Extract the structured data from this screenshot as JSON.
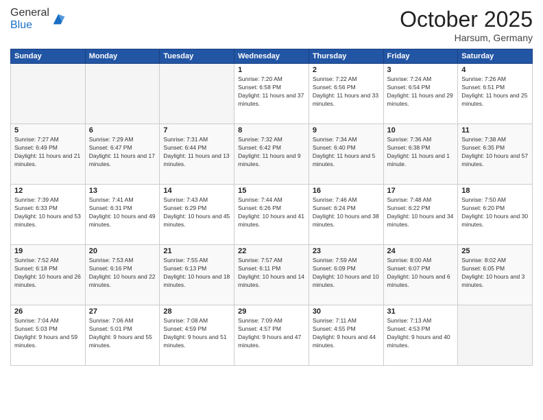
{
  "header": {
    "logo_general": "General",
    "logo_blue": "Blue",
    "month": "October 2025",
    "location": "Harsum, Germany"
  },
  "days_of_week": [
    "Sunday",
    "Monday",
    "Tuesday",
    "Wednesday",
    "Thursday",
    "Friday",
    "Saturday"
  ],
  "weeks": [
    [
      {
        "day": "",
        "info": ""
      },
      {
        "day": "",
        "info": ""
      },
      {
        "day": "",
        "info": ""
      },
      {
        "day": "1",
        "info": "Sunrise: 7:20 AM\nSunset: 6:58 PM\nDaylight: 11 hours and 37 minutes."
      },
      {
        "day": "2",
        "info": "Sunrise: 7:22 AM\nSunset: 6:56 PM\nDaylight: 11 hours and 33 minutes."
      },
      {
        "day": "3",
        "info": "Sunrise: 7:24 AM\nSunset: 6:54 PM\nDaylight: 11 hours and 29 minutes."
      },
      {
        "day": "4",
        "info": "Sunrise: 7:26 AM\nSunset: 6:51 PM\nDaylight: 11 hours and 25 minutes."
      }
    ],
    [
      {
        "day": "5",
        "info": "Sunrise: 7:27 AM\nSunset: 6:49 PM\nDaylight: 11 hours and 21 minutes."
      },
      {
        "day": "6",
        "info": "Sunrise: 7:29 AM\nSunset: 6:47 PM\nDaylight: 11 hours and 17 minutes."
      },
      {
        "day": "7",
        "info": "Sunrise: 7:31 AM\nSunset: 6:44 PM\nDaylight: 11 hours and 13 minutes."
      },
      {
        "day": "8",
        "info": "Sunrise: 7:32 AM\nSunset: 6:42 PM\nDaylight: 11 hours and 9 minutes."
      },
      {
        "day": "9",
        "info": "Sunrise: 7:34 AM\nSunset: 6:40 PM\nDaylight: 11 hours and 5 minutes."
      },
      {
        "day": "10",
        "info": "Sunrise: 7:36 AM\nSunset: 6:38 PM\nDaylight: 11 hours and 1 minute."
      },
      {
        "day": "11",
        "info": "Sunrise: 7:38 AM\nSunset: 6:35 PM\nDaylight: 10 hours and 57 minutes."
      }
    ],
    [
      {
        "day": "12",
        "info": "Sunrise: 7:39 AM\nSunset: 6:33 PM\nDaylight: 10 hours and 53 minutes."
      },
      {
        "day": "13",
        "info": "Sunrise: 7:41 AM\nSunset: 6:31 PM\nDaylight: 10 hours and 49 minutes."
      },
      {
        "day": "14",
        "info": "Sunrise: 7:43 AM\nSunset: 6:29 PM\nDaylight: 10 hours and 45 minutes."
      },
      {
        "day": "15",
        "info": "Sunrise: 7:44 AM\nSunset: 6:26 PM\nDaylight: 10 hours and 41 minutes."
      },
      {
        "day": "16",
        "info": "Sunrise: 7:46 AM\nSunset: 6:24 PM\nDaylight: 10 hours and 38 minutes."
      },
      {
        "day": "17",
        "info": "Sunrise: 7:48 AM\nSunset: 6:22 PM\nDaylight: 10 hours and 34 minutes."
      },
      {
        "day": "18",
        "info": "Sunrise: 7:50 AM\nSunset: 6:20 PM\nDaylight: 10 hours and 30 minutes."
      }
    ],
    [
      {
        "day": "19",
        "info": "Sunrise: 7:52 AM\nSunset: 6:18 PM\nDaylight: 10 hours and 26 minutes."
      },
      {
        "day": "20",
        "info": "Sunrise: 7:53 AM\nSunset: 6:16 PM\nDaylight: 10 hours and 22 minutes."
      },
      {
        "day": "21",
        "info": "Sunrise: 7:55 AM\nSunset: 6:13 PM\nDaylight: 10 hours and 18 minutes."
      },
      {
        "day": "22",
        "info": "Sunrise: 7:57 AM\nSunset: 6:11 PM\nDaylight: 10 hours and 14 minutes."
      },
      {
        "day": "23",
        "info": "Sunrise: 7:59 AM\nSunset: 6:09 PM\nDaylight: 10 hours and 10 minutes."
      },
      {
        "day": "24",
        "info": "Sunrise: 8:00 AM\nSunset: 6:07 PM\nDaylight: 10 hours and 6 minutes."
      },
      {
        "day": "25",
        "info": "Sunrise: 8:02 AM\nSunset: 6:05 PM\nDaylight: 10 hours and 3 minutes."
      }
    ],
    [
      {
        "day": "26",
        "info": "Sunrise: 7:04 AM\nSunset: 5:03 PM\nDaylight: 9 hours and 59 minutes."
      },
      {
        "day": "27",
        "info": "Sunrise: 7:06 AM\nSunset: 5:01 PM\nDaylight: 9 hours and 55 minutes."
      },
      {
        "day": "28",
        "info": "Sunrise: 7:08 AM\nSunset: 4:59 PM\nDaylight: 9 hours and 51 minutes."
      },
      {
        "day": "29",
        "info": "Sunrise: 7:09 AM\nSunset: 4:57 PM\nDaylight: 9 hours and 47 minutes."
      },
      {
        "day": "30",
        "info": "Sunrise: 7:11 AM\nSunset: 4:55 PM\nDaylight: 9 hours and 44 minutes."
      },
      {
        "day": "31",
        "info": "Sunrise: 7:13 AM\nSunset: 4:53 PM\nDaylight: 9 hours and 40 minutes."
      },
      {
        "day": "",
        "info": ""
      }
    ]
  ]
}
